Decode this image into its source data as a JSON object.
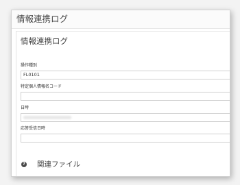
{
  "window": {
    "title": "情報連携ログ"
  },
  "panel": {
    "title": "情報連携ログ"
  },
  "fields": [
    {
      "label": "操作種別",
      "value": "FL0101"
    },
    {
      "label": "特定個人情報名コード",
      "value": ""
    },
    {
      "label": "日時",
      "value": ""
    },
    {
      "label": "応答受信日時",
      "value": ""
    }
  ],
  "related": {
    "label": "関連ファイル",
    "icon": "question-icon"
  }
}
